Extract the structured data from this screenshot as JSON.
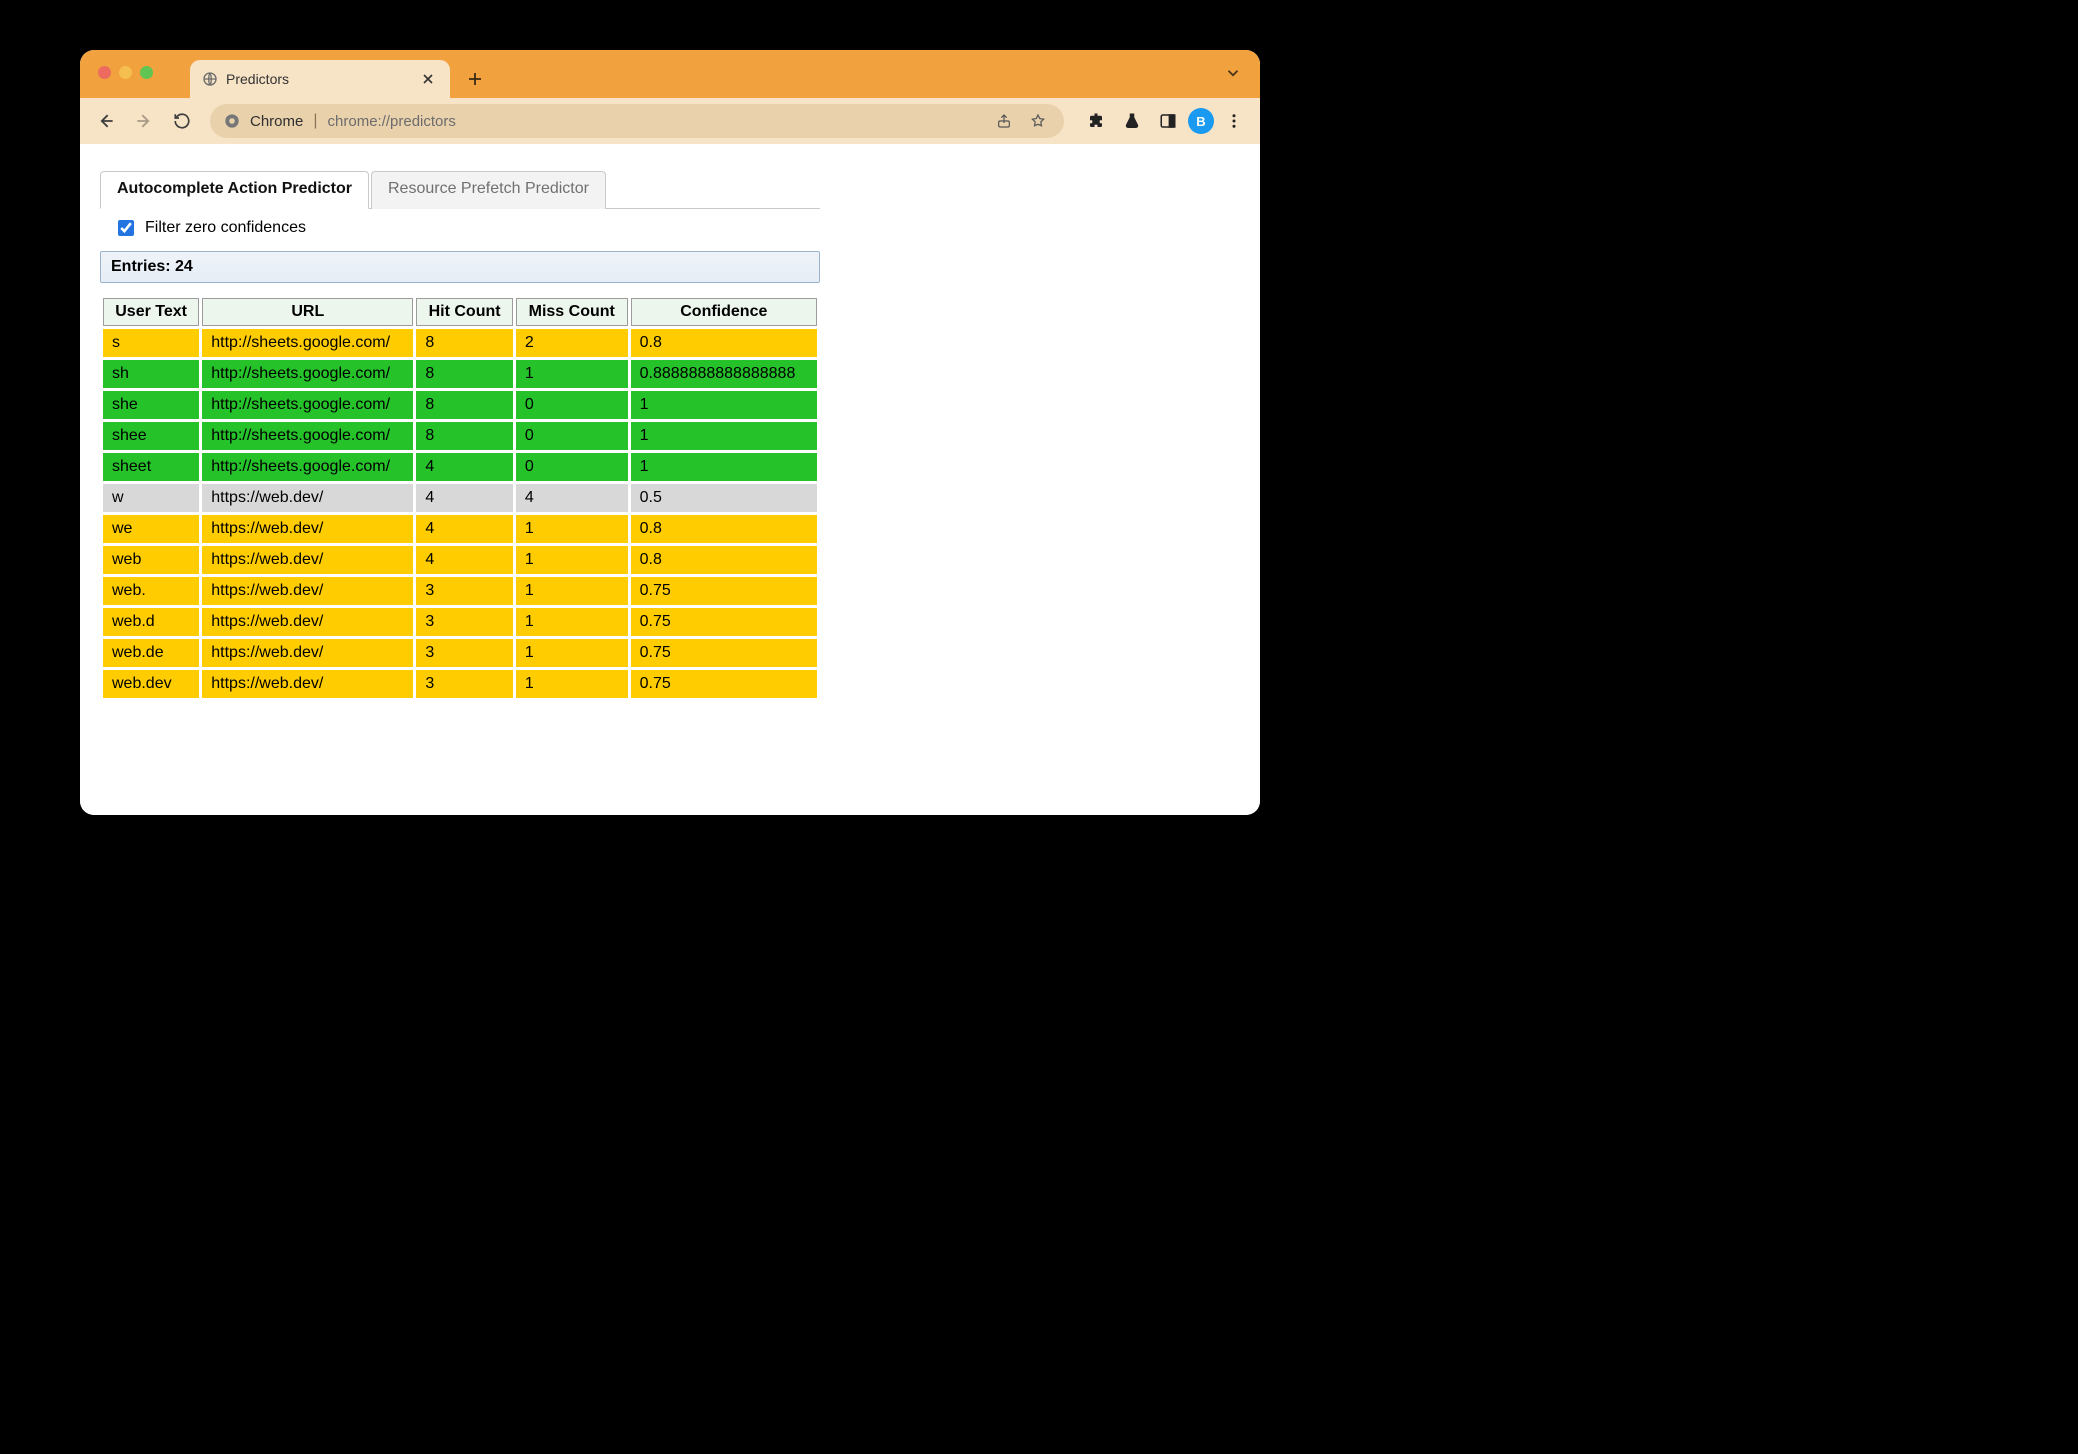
{
  "browser": {
    "tab_title": "Predictors",
    "omnibox_host": "Chrome",
    "omnibox_path": "chrome://predictors",
    "avatar_letter": "B"
  },
  "page": {
    "tabs": [
      {
        "label": "Autocomplete Action Predictor",
        "active": true
      },
      {
        "label": "Resource Prefetch Predictor",
        "active": false
      }
    ],
    "filter_label": "Filter zero confidences",
    "filter_checked": true,
    "entries_label": "Entries: 24",
    "columns": [
      "User Text",
      "URL",
      "Hit Count",
      "Miss Count",
      "Confidence"
    ],
    "rows": [
      {
        "user_text": "s",
        "url": "http://sheets.google.com/",
        "hit": "8",
        "miss": "2",
        "conf": "0.8",
        "cls": "row-yellow"
      },
      {
        "user_text": "sh",
        "url": "http://sheets.google.com/",
        "hit": "8",
        "miss": "1",
        "conf": "0.8888888888888888",
        "cls": "row-green"
      },
      {
        "user_text": "she",
        "url": "http://sheets.google.com/",
        "hit": "8",
        "miss": "0",
        "conf": "1",
        "cls": "row-green"
      },
      {
        "user_text": "shee",
        "url": "http://sheets.google.com/",
        "hit": "8",
        "miss": "0",
        "conf": "1",
        "cls": "row-green"
      },
      {
        "user_text": "sheet",
        "url": "http://sheets.google.com/",
        "hit": "4",
        "miss": "0",
        "conf": "1",
        "cls": "row-green"
      },
      {
        "user_text": "w",
        "url": "https://web.dev/",
        "hit": "4",
        "miss": "4",
        "conf": "0.5",
        "cls": "row-grey"
      },
      {
        "user_text": "we",
        "url": "https://web.dev/",
        "hit": "4",
        "miss": "1",
        "conf": "0.8",
        "cls": "row-yellow"
      },
      {
        "user_text": "web",
        "url": "https://web.dev/",
        "hit": "4",
        "miss": "1",
        "conf": "0.8",
        "cls": "row-yellow"
      },
      {
        "user_text": "web.",
        "url": "https://web.dev/",
        "hit": "3",
        "miss": "1",
        "conf": "0.75",
        "cls": "row-yellow"
      },
      {
        "user_text": "web.d",
        "url": "https://web.dev/",
        "hit": "3",
        "miss": "1",
        "conf": "0.75",
        "cls": "row-yellow"
      },
      {
        "user_text": "web.de",
        "url": "https://web.dev/",
        "hit": "3",
        "miss": "1",
        "conf": "0.75",
        "cls": "row-yellow"
      },
      {
        "user_text": "web.dev",
        "url": "https://web.dev/",
        "hit": "3",
        "miss": "1",
        "conf": "0.75",
        "cls": "row-yellow"
      }
    ]
  }
}
